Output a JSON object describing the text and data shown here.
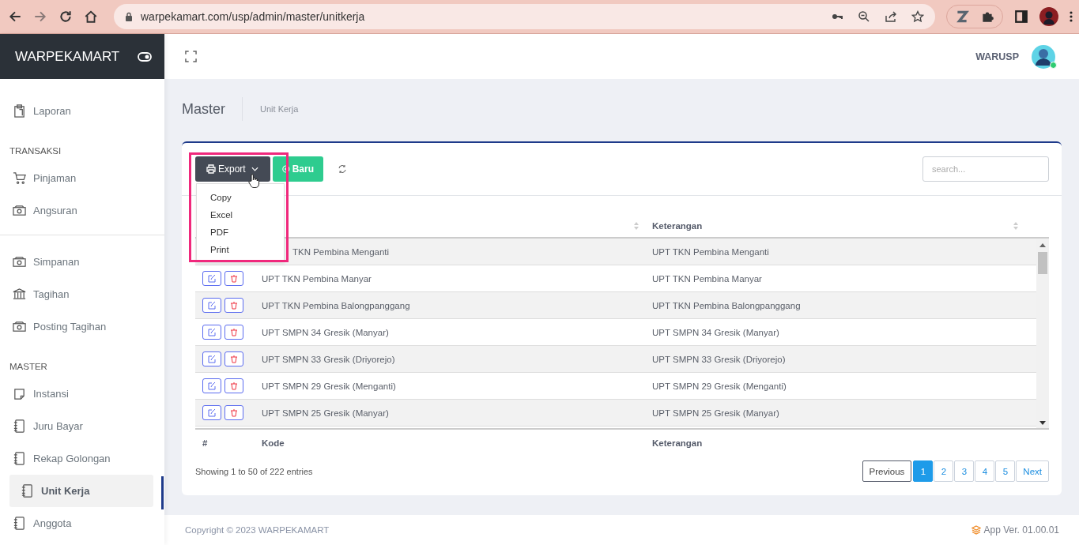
{
  "browser": {
    "url": "warpekamart.com/usp/admin/master/unitkerja"
  },
  "brand": "WARPEKAMART",
  "sidebar": {
    "items": [
      {
        "kind": "item",
        "label": "Laporan",
        "selected": false
      },
      {
        "kind": "heading",
        "label": "TRANSAKSI"
      },
      {
        "kind": "item",
        "label": "Pinjaman",
        "selected": false
      },
      {
        "kind": "item",
        "label": "Angsuran",
        "selected": false
      },
      {
        "kind": "divider"
      },
      {
        "kind": "item",
        "label": "Simpanan",
        "selected": false
      },
      {
        "kind": "item",
        "label": "Tagihan",
        "selected": false
      },
      {
        "kind": "item",
        "label": "Posting Tagihan",
        "selected": false
      },
      {
        "kind": "heading",
        "label": "MASTER"
      },
      {
        "kind": "item",
        "label": "Instansi",
        "selected": false
      },
      {
        "kind": "item",
        "label": "Juru Bayar",
        "selected": false
      },
      {
        "kind": "item",
        "label": "Rekap Golongan",
        "selected": false
      },
      {
        "kind": "item",
        "label": "Unit Kerja",
        "selected": true
      },
      {
        "kind": "item",
        "label": "Anggota",
        "selected": false
      }
    ]
  },
  "user": {
    "name": "WARUSP",
    "online": true
  },
  "page": {
    "title": "Master",
    "breadcrumb": "Unit Kerja"
  },
  "toolbar": {
    "export": "Export",
    "new": "Baru",
    "search": {
      "placeholder": "search..."
    }
  },
  "export_menu": {
    "expanded": true,
    "items": [
      "Copy",
      "Excel",
      "PDF",
      "Print"
    ]
  },
  "table": {
    "header_columns": [
      "Keterangan"
    ],
    "rows": [
      {
        "kode": "TKN Pembina Menganti",
        "keterangan": "UPT TKN Pembina Menganti",
        "actions": false
      },
      {
        "kode": "UPT TKN Pembina Manyar",
        "keterangan": "UPT TKN Pembina Manyar"
      },
      {
        "kode": "UPT TKN Pembina Balongpanggang",
        "keterangan": "UPT TKN Pembina Balongpanggang"
      },
      {
        "kode": "UPT SMPN 34 Gresik (Manyar)",
        "keterangan": "UPT SMPN 34 Gresik (Manyar)"
      },
      {
        "kode": "UPT SMPN 33 Gresik (Driyorejo)",
        "keterangan": "UPT SMPN 33 Gresik (Driyorejo)"
      },
      {
        "kode": "UPT SMPN 29 Gresik (Menganti)",
        "keterangan": "UPT SMPN 29 Gresik (Menganti)"
      },
      {
        "kode": "UPT SMPN 25 Gresik (Manyar)",
        "keterangan": "UPT SMPN 25 Gresik (Manyar)"
      }
    ],
    "footer_columns": [
      "#",
      "Kode",
      "Keterangan"
    ]
  },
  "info": "Showing 1 to 50 of 222 entries",
  "pagination": {
    "previous": "Previous",
    "pages": [
      {
        "label": "1",
        "selected": true
      },
      {
        "label": "2",
        "selected": false
      },
      {
        "label": "3",
        "selected": false
      },
      {
        "label": "4",
        "selected": false
      },
      {
        "label": "5",
        "selected": false
      }
    ],
    "next": "Next"
  },
  "footer": {
    "copyright": "Copyright © 2023 WARPEKAMART",
    "version": "App Ver. 01.00.01"
  }
}
